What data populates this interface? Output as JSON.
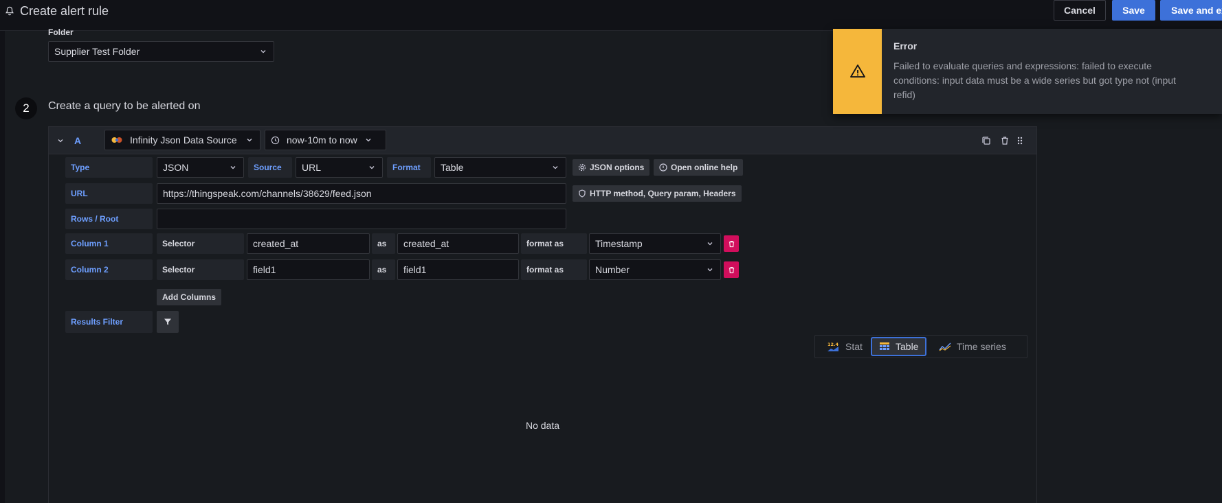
{
  "header": {
    "title": "Create alert rule",
    "cancel_label": "Cancel",
    "save_label": "Save",
    "save_exit_label": "Save and ex"
  },
  "folder": {
    "label": "Folder",
    "value": "Supplier Test Folder"
  },
  "step": {
    "number": "2",
    "title": "Create a query to be alerted on"
  },
  "query": {
    "refid": "A",
    "datasource": "Infinity Json Data Source",
    "time_range": "now-10m to now",
    "type_label": "Type",
    "type_value": "JSON",
    "source_label": "Source",
    "source_value": "URL",
    "format_label": "Format",
    "format_value": "Table",
    "json_options_label": "JSON options",
    "online_help_label": "Open online help",
    "url_label": "URL",
    "url_value": "https://thingspeak.com/channels/38629/feed.json",
    "http_label": "HTTP method, Query param, Headers",
    "rows_root_label": "Rows / Root",
    "rows_root_value": "",
    "columns": [
      {
        "label": "Column 1",
        "selector_label": "Selector",
        "selector": "created_at",
        "as_label": "as",
        "alias": "created_at",
        "format_label": "format as",
        "format": "Timestamp"
      },
      {
        "label": "Column 2",
        "selector_label": "Selector",
        "selector": "field1",
        "as_label": "as",
        "alias": "field1",
        "format_label": "format as",
        "format": "Number"
      }
    ],
    "add_columns_label": "Add Columns",
    "results_filter_label": "Results Filter"
  },
  "viz": {
    "stat_label": "Stat",
    "stat_icon_text": "12.4",
    "table_label": "Table",
    "timeseries_label": "Time series",
    "no_data": "No data"
  },
  "toast": {
    "title": "Error",
    "message": "Failed to evaluate queries and expressions: failed to execute conditions: input data must be a wide series but got type not (input refid)"
  },
  "colors": {
    "accent": "#3d71d9",
    "warning": "#f5b73b",
    "danger": "#d10e5c",
    "label_blue": "#6e9fff"
  }
}
